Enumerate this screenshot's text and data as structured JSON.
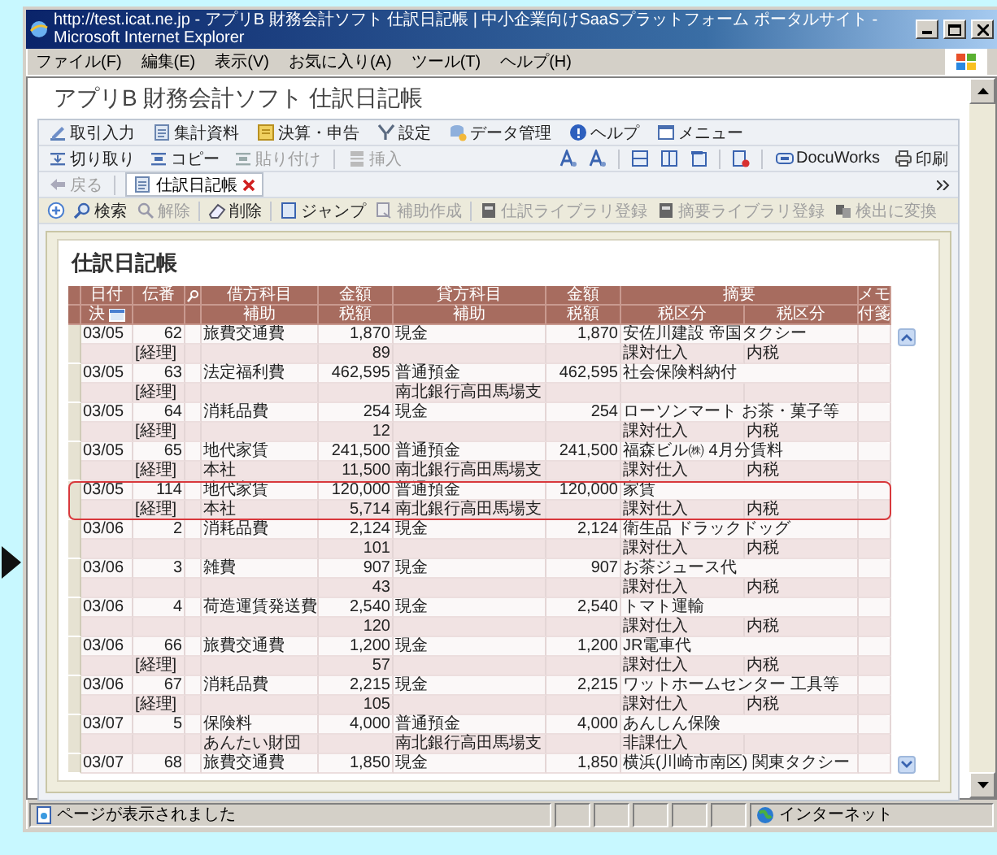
{
  "browser": {
    "title": "http://test.icat.ne.jp - アプリB  財務会計ソフト  仕訳日記帳 | 中小企業向けSaaSプラットフォーム ポータルサイト - Microsoft Internet Explorer",
    "menu": [
      "ファイル(F)",
      "編集(E)",
      "表示(V)",
      "お気に入り(A)",
      "ツール(T)",
      "ヘルプ(H)"
    ],
    "status": "ページが表示されました",
    "zone": "インターネット"
  },
  "app": {
    "title": "アプリB  財務会計ソフト  仕訳日記帳",
    "main_toolbar": [
      {
        "label": "取引入力"
      },
      {
        "label": "集計資料"
      },
      {
        "label": "決算・申告"
      },
      {
        "label": "設定"
      },
      {
        "label": "データ管理"
      },
      {
        "label": "ヘルプ"
      },
      {
        "label": "メニュー"
      }
    ],
    "edit_toolbar": [
      {
        "label": "切り取り",
        "disabled": false
      },
      {
        "label": "コピー",
        "disabled": false
      },
      {
        "label": "貼り付け",
        "disabled": true
      },
      {
        "label": "挿入",
        "disabled": true
      }
    ],
    "output_toolbar": [
      {
        "label": "DocuWorks"
      },
      {
        "label": "印刷"
      }
    ],
    "back": {
      "label": "戻る",
      "disabled": true
    },
    "tabs": [
      {
        "label": "仕訳日記帳",
        "selected": true
      }
    ],
    "journal_toolbar": [
      {
        "label": "検索",
        "disabled": false
      },
      {
        "label": "解除",
        "disabled": true
      },
      {
        "label": "削除",
        "disabled": false
      },
      {
        "label": "ジャンプ",
        "disabled": false
      },
      {
        "label": "補助作成",
        "disabled": true
      },
      {
        "label": "仕訳ライブラリ登録",
        "disabled": true
      },
      {
        "label": "摘要ライブラリ登録",
        "disabled": true
      },
      {
        "label": "検出に変換",
        "disabled": true
      }
    ]
  },
  "journal": {
    "heading": "仕訳日記帳",
    "columns": [
      {
        "label": "日付",
        "sub": "決"
      },
      {
        "label": "伝番"
      },
      {
        "label": "借方科目",
        "sub": "補助"
      },
      {
        "label": "金額",
        "sub": "税額"
      },
      {
        "label": "貸方科目",
        "sub": "補助"
      },
      {
        "label": "金額",
        "sub": "税額"
      },
      {
        "label": "摘要",
        "subs": [
          "税区分",
          "税区分"
        ]
      },
      {
        "label": "メモ",
        "sub": "付箋"
      }
    ],
    "entries": [
      {
        "date": "03/05",
        "no": "62",
        "tag": "[経理]",
        "debit": "旅費交通費",
        "amount": "1,870",
        "tax": "89",
        "credit": "現金",
        "credit_amount": "1,870",
        "summary": "安佐川建設  帝国タクシー",
        "tax_class": "課対仕入",
        "tax_type": "内税",
        "selected": false
      },
      {
        "date": "03/05",
        "no": "63",
        "tag": "[経理]",
        "debit": "法定福利費",
        "amount": "462,595",
        "credit": "普通預金",
        "credit_sub": "南北銀行高田馬場支",
        "credit_amount": "462,595",
        "summary": "社会保険料納付",
        "selected": false
      },
      {
        "date": "03/05",
        "no": "64",
        "tag": "[経理]",
        "debit": "消耗品費",
        "amount": "254",
        "tax": "12",
        "credit": "現金",
        "credit_amount": "254",
        "summary": "ローソンマート  お茶・菓子等",
        "tax_class": "課対仕入",
        "tax_type": "内税",
        "selected": false
      },
      {
        "date": "03/05",
        "no": "65",
        "tag": "[経理]",
        "debit": "地代家賃",
        "debit_sub": "本社",
        "amount": "241,500",
        "tax": "11,500",
        "credit": "普通預金",
        "credit_sub": "南北銀行高田馬場支",
        "credit_amount": "241,500",
        "summary": "福森ビル㈱  4月分賃料",
        "tax_class": "課対仕入",
        "tax_type": "内税",
        "selected": false
      },
      {
        "date": "03/05",
        "no": "114",
        "tag": "[経理]",
        "debit": "地代家賃",
        "debit_sub": "本社",
        "amount": "120,000",
        "tax": "5,714",
        "credit": "普通預金",
        "credit_sub": "南北銀行高田馬場支",
        "credit_amount": "120,000",
        "summary": "家賃",
        "tax_class": "課対仕入",
        "tax_type": "内税",
        "selected": true
      },
      {
        "date": "03/06",
        "no": "2",
        "debit": "消耗品費",
        "amount": "2,124",
        "tax": "101",
        "credit": "現金",
        "credit_amount": "2,124",
        "summary": "衛生品  ドラックドッグ",
        "tax_class": "課対仕入",
        "tax_type": "内税",
        "selected": false
      },
      {
        "date": "03/06",
        "no": "3",
        "debit": "雑費",
        "amount": "907",
        "tax": "43",
        "credit": "現金",
        "credit_amount": "907",
        "summary": "お茶ジュース代",
        "tax_class": "課対仕入",
        "tax_type": "内税",
        "selected": false
      },
      {
        "date": "03/06",
        "no": "4",
        "debit": "荷造運賃発送費",
        "amount": "2,540",
        "tax": "120",
        "credit": "現金",
        "credit_amount": "2,540",
        "summary": "トマト運輸",
        "tax_class": "課対仕入",
        "tax_type": "内税",
        "selected": false
      },
      {
        "date": "03/06",
        "no": "66",
        "tag": "[経理]",
        "debit": "旅費交通費",
        "amount": "1,200",
        "tax": "57",
        "credit": "現金",
        "credit_amount": "1,200",
        "summary": "JR電車代",
        "tax_class": "課対仕入",
        "tax_type": "内税",
        "selected": false
      },
      {
        "date": "03/06",
        "no": "67",
        "tag": "[経理]",
        "debit": "消耗品費",
        "amount": "2,215",
        "tax": "105",
        "credit": "現金",
        "credit_amount": "2,215",
        "summary": "ワットホームセンター  工具等",
        "tax_class": "課対仕入",
        "tax_type": "内税",
        "selected": false
      },
      {
        "date": "03/07",
        "no": "5",
        "debit": "保険料",
        "debit_sub": "あんたい財団",
        "amount": "4,000",
        "credit": "普通預金",
        "credit_sub": "南北銀行高田馬場支",
        "credit_amount": "4,000",
        "summary": "あんしん保険",
        "tax_class": "非課仕入",
        "selected": false
      },
      {
        "date": "03/07",
        "no": "68",
        "debit": "旅費交通費",
        "amount": "1,850",
        "credit": "現金",
        "credit_amount": "1,850",
        "summary": "横浜(川崎市南区)  関東タクシー",
        "selected": false
      }
    ]
  }
}
